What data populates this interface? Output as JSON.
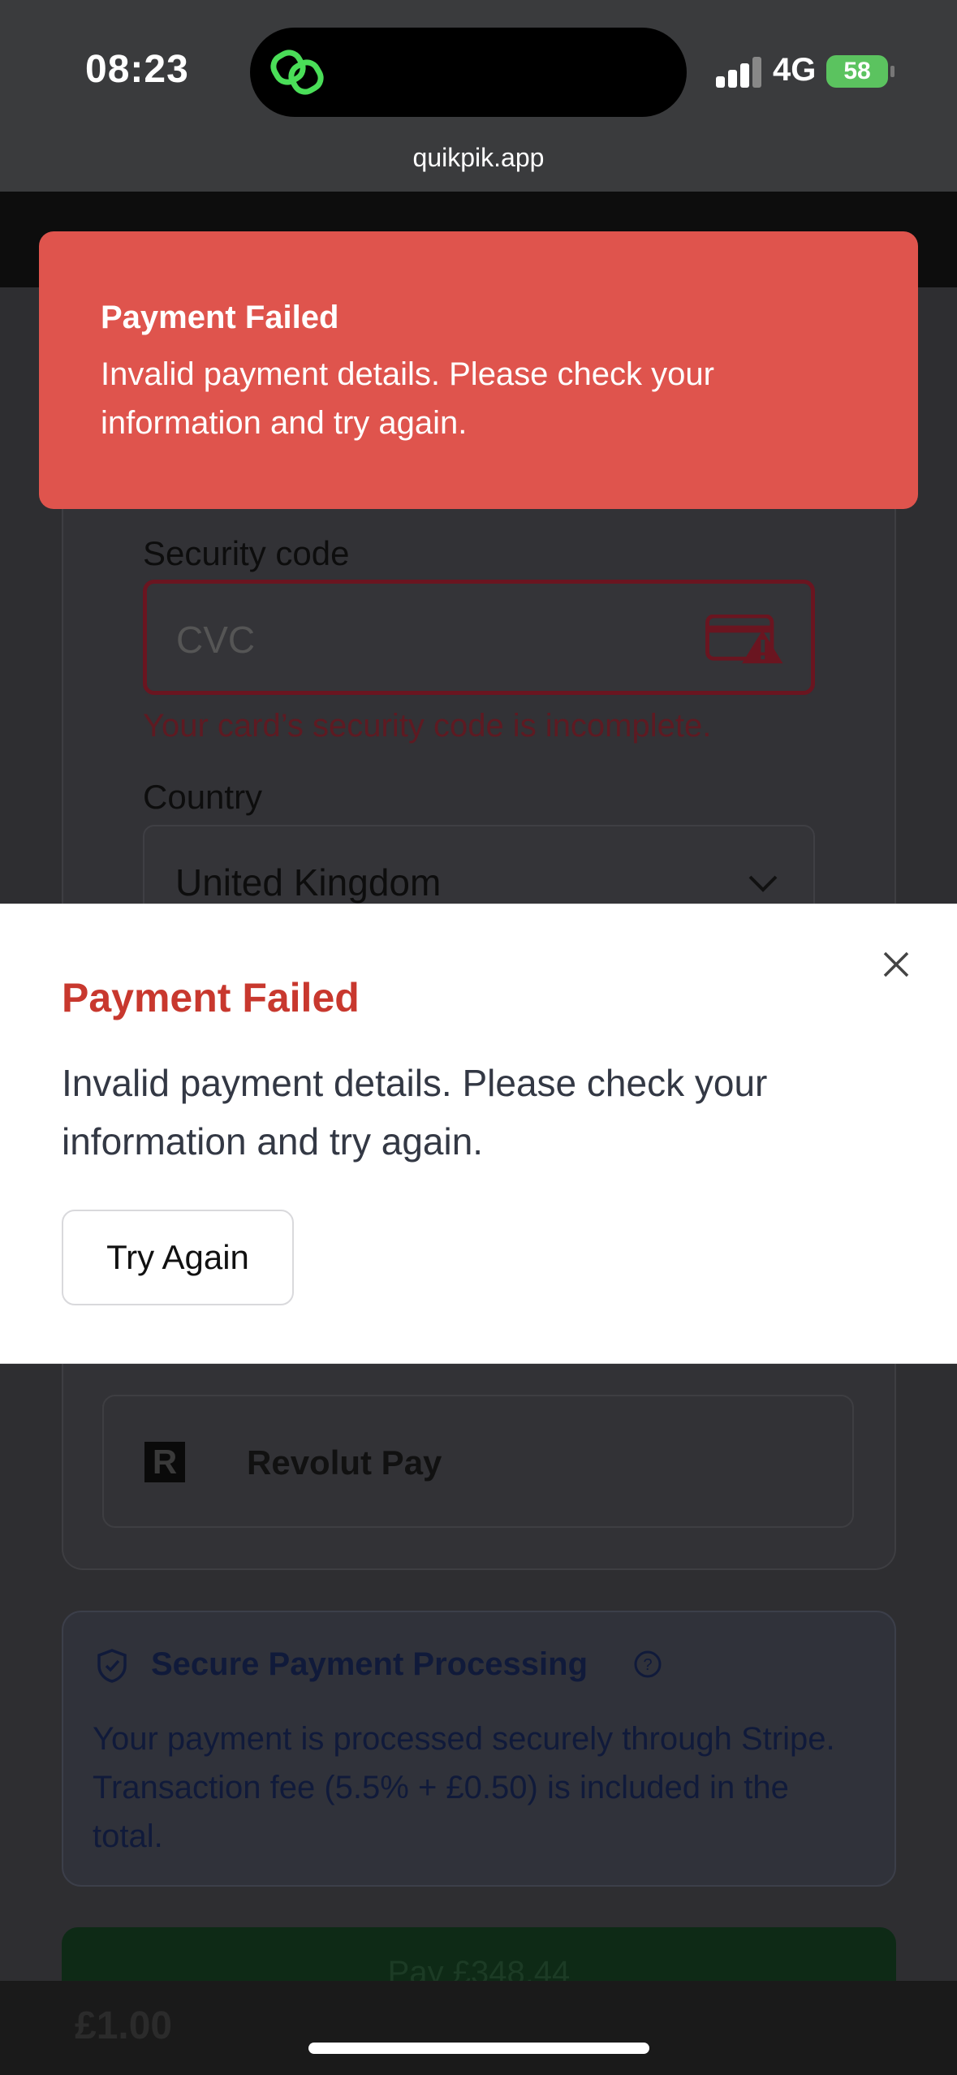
{
  "status_bar": {
    "time": "08:23",
    "network": "4G",
    "battery": "58"
  },
  "browser": {
    "url": "quikpik.app"
  },
  "form": {
    "security_code_label": "Security code",
    "cvc_placeholder": "CVC",
    "cvc_error": "Your card’s security code is incomplete.",
    "country_label": "Country",
    "country_value": "United Kingdom"
  },
  "payment_methods": {
    "revolut_label": "Revolut Pay"
  },
  "secure_info": {
    "title": "Secure Payment Processing",
    "body": "Your payment is processed securely through Stripe. Transaction fee (5.5% + £0.50) is included in the total."
  },
  "pay_button": {
    "label": "Pay £348.44"
  },
  "bottom_bar": {
    "amount": "£1.00"
  },
  "toast": {
    "title": "Payment Failed",
    "message": "Invalid payment details. Please check your information and try again."
  },
  "dialog": {
    "title": "Payment Failed",
    "message": "Invalid payment details. Please check your information and try again.",
    "try_again_label": "Try Again"
  },
  "colors": {
    "toast_bg": "#df544d",
    "dialog_title": "#c8382e",
    "battery": "#5bc35f"
  },
  "icons": [
    "link-app-icon",
    "signal-icon",
    "battery-icon",
    "card-error-icon",
    "chevron-down-icon",
    "revolut-logo-icon",
    "shield-check-icon",
    "help-circle-icon",
    "close-icon"
  ]
}
